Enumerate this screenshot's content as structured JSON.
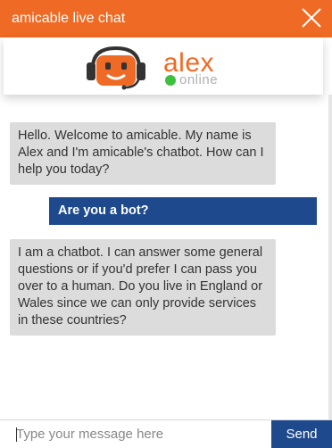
{
  "header": {
    "title": "amicable live chat",
    "close_icon": "close-icon",
    "color": "#ef6a24"
  },
  "bot": {
    "name": "alex",
    "status": "online",
    "status_color": "#3cc13c",
    "avatar_icon": "robot-headset-icon"
  },
  "messages": [
    {
      "sender": "bot",
      "text": "Hello. Welcome to amicable. My name is Alex and I'm amicable's chatbot. How can I help you today?"
    },
    {
      "sender": "user",
      "text": "Are you a bot?"
    },
    {
      "sender": "bot",
      "text": "I am a chatbot. I can answer some general questions or if you'd prefer I can pass you over to a human. Do you live in England or Wales since we can only provide services in these countries?"
    }
  ],
  "composer": {
    "placeholder": "Type your message here",
    "send_label": "Send",
    "send_color": "#1e4a8d"
  }
}
